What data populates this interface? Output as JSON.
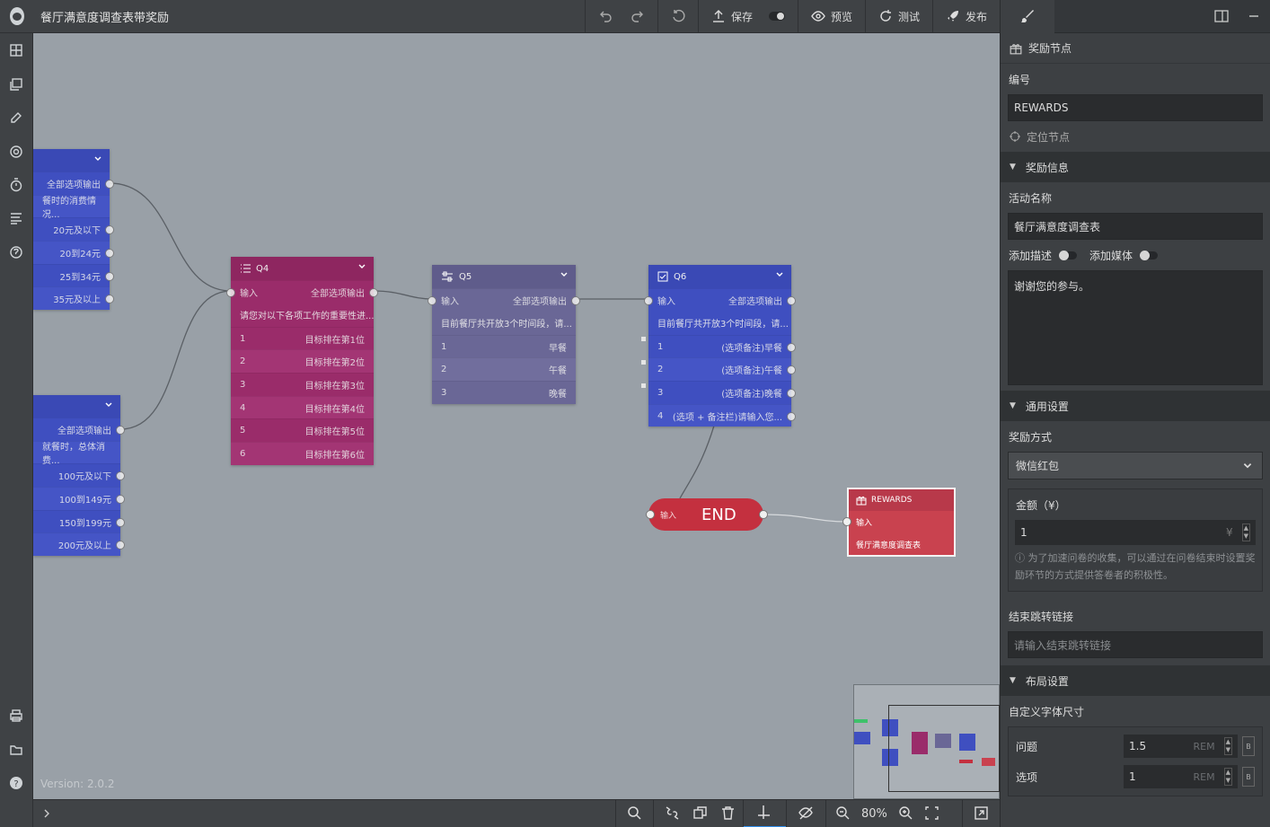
{
  "app": {
    "title": "餐厅满意度调查表带奖励",
    "version": "Version: 2.0.2"
  },
  "toolbar": {
    "save": "保存",
    "preview": "预览",
    "test": "测试",
    "publish": "发布"
  },
  "nodes": {
    "q_top": {
      "rows": [
        "全部选项输出",
        "餐时的消费情况...",
        "20元及以下",
        "20到24元",
        "25到34元",
        "35元及以上"
      ]
    },
    "q_bottom": {
      "rows": [
        "全部选项输出",
        "就餐时，总体消费...",
        "100元及以下",
        "100到149元",
        "150到199元",
        "200元及以上"
      ]
    },
    "q4": {
      "title": "Q4",
      "input": "输入",
      "output": "全部选项输出",
      "desc": "请您对以下各项工作的重要性进...",
      "options": [
        {
          "n": "1",
          "t": "目标排在第1位"
        },
        {
          "n": "2",
          "t": "目标排在第2位"
        },
        {
          "n": "3",
          "t": "目标排在第3位"
        },
        {
          "n": "4",
          "t": "目标排在第4位"
        },
        {
          "n": "5",
          "t": "目标排在第5位"
        },
        {
          "n": "6",
          "t": "目标排在第6位"
        }
      ]
    },
    "q5": {
      "title": "Q5",
      "input": "输入",
      "output": "全部选项输出",
      "desc": "目前餐厅共开放3个时间段，请...",
      "options": [
        {
          "n": "1",
          "t": "早餐"
        },
        {
          "n": "2",
          "t": "午餐"
        },
        {
          "n": "3",
          "t": "晚餐"
        }
      ]
    },
    "q6": {
      "title": "Q6",
      "input": "输入",
      "output": "全部选项输出",
      "desc": "目前餐厅共开放3个时间段，请...",
      "options": [
        {
          "n": "1",
          "t": "(选项备注)早餐"
        },
        {
          "n": "2",
          "t": "(选项备注)午餐"
        },
        {
          "n": "3",
          "t": "(选项备注)晚餐"
        },
        {
          "n": "4",
          "t": "(选项 + 备注栏)请输入您..."
        }
      ]
    },
    "end": {
      "input": "输入",
      "label": "END"
    },
    "rewards": {
      "title": "REWARDS",
      "input": "输入",
      "desc": "餐厅满意度调查表"
    }
  },
  "zoom": "80%",
  "panel": {
    "node_type": "奖励节点",
    "id_label": "编号",
    "id_value": "REWARDS",
    "locate": "定位节点",
    "sec_reward": "奖励信息",
    "activity_label": "活动名称",
    "activity_value": "餐厅满意度调查表",
    "add_desc": "添加描述",
    "add_media": "添加媒体",
    "message": "谢谢您的参与。",
    "sec_general": "通用设置",
    "method_label": "奖励方式",
    "method_value": "微信红包",
    "amount_label": "金额（¥）",
    "amount_value": "1",
    "currency": "¥",
    "amount_hint": "为了加速问卷的收集，可以通过在问卷结束时设置奖励环节的方式提供答卷者的积极性。",
    "jump_label": "结束跳转链接",
    "jump_placeholder": "请输入结束跳转链接",
    "sec_layout": "布局设置",
    "font_label": "自定义字体尺寸",
    "question_label": "问题",
    "question_value": "1.5",
    "option_label": "选项",
    "option_value": "1",
    "unit": "REM",
    "bold": "B"
  },
  "colors": {
    "canvas": "#99a0a7",
    "blue_node": "#3f4fc0",
    "pink_node": "#9a2c6a",
    "purple_node": "#6a6796",
    "end_node": "#c4303f",
    "rewards_node": "#c9424f"
  }
}
